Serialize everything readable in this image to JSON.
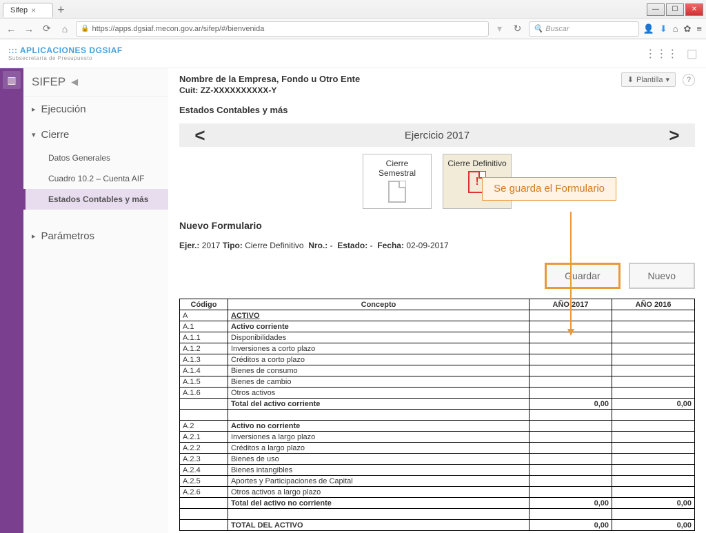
{
  "browser": {
    "tab_title": "Sifep",
    "url": "https://apps.dgsiaf.mecon.gov.ar/sifep/#/bienvenida",
    "search_placeholder": "Buscar"
  },
  "header": {
    "logo_line1": "APLICACIONES DGSIAF",
    "logo_line2": "Subsecretaría de Presupuesto",
    "plantilla_label": "Plantilla"
  },
  "sidebar": {
    "title": "SIFEP",
    "items": [
      {
        "label": "Ejecución",
        "expanded": false
      },
      {
        "label": "Cierre",
        "expanded": true,
        "children": [
          {
            "label": "Datos Generales",
            "active": false
          },
          {
            "label": "Cuadro 10.2  – Cuenta AIF",
            "active": false
          },
          {
            "label": "Estados Contables y más",
            "active": true
          }
        ]
      },
      {
        "label": "Parámetros",
        "expanded": false
      }
    ]
  },
  "main": {
    "company": "Nombre de la Empresa, Fondo u Otro Ente",
    "cuit": "Cuit: ZZ-XXXXXXXXXX-Y",
    "section": "Estados Contables y más",
    "ejercicio_label": "Ejercicio 2017",
    "cards": [
      {
        "label": "Cierre Semestral",
        "active": false
      },
      {
        "label": "Cierre Definitivo",
        "active": true
      }
    ],
    "form_title": "Nuevo Formulario",
    "meta": {
      "ejer_label": "Ejer.:",
      "ejer": "2017",
      "tipo_label": "Tipo:",
      "tipo": "Cierre Definitivo",
      "nro_label": "Nro.:",
      "nro": "-",
      "estado_label": "Estado:",
      "estado": "-",
      "fecha_label": "Fecha:",
      "fecha": "02-09-2017"
    },
    "buttons": {
      "guardar": "Guardar",
      "nuevo": "Nuevo"
    },
    "annotation": "Se guarda el Formulario"
  },
  "table": {
    "headers": [
      "Código",
      "Concepto",
      "AÑO 2017",
      "AÑO 2016"
    ],
    "rows": [
      {
        "codigo": "A",
        "concepto": "ACTIVO",
        "bold": true,
        "underline": true
      },
      {
        "codigo": "A.1",
        "concepto": "Activo corriente",
        "bold": true
      },
      {
        "codigo": "A.1.1",
        "concepto": "Disponibilidades"
      },
      {
        "codigo": "A.1.2",
        "concepto": "Inversiones a corto plazo"
      },
      {
        "codigo": "A.1.3",
        "concepto": "Créditos a corto plazo"
      },
      {
        "codigo": "A.1.4",
        "concepto": "Bienes de consumo"
      },
      {
        "codigo": "A.1.5",
        "concepto": "Bienes de cambio"
      },
      {
        "codigo": "A.1.6",
        "concepto": "Otros activos"
      },
      {
        "codigo": "",
        "concepto": "Total del activo corriente",
        "bold": true,
        "y1": "0,00",
        "y2": "0,00"
      },
      {
        "codigo": "",
        "concepto": ""
      },
      {
        "codigo": "A.2",
        "concepto": "Activo no corriente",
        "bold": true
      },
      {
        "codigo": "A.2.1",
        "concepto": "Inversiones a largo plazo"
      },
      {
        "codigo": "A.2.2",
        "concepto": "Créditos a largo plazo"
      },
      {
        "codigo": "A.2.3",
        "concepto": "Bienes de uso"
      },
      {
        "codigo": "A.2.4",
        "concepto": "Bienes intangibles"
      },
      {
        "codigo": "A.2.5",
        "concepto": "Aportes y Participaciones de Capital"
      },
      {
        "codigo": "A.2.6",
        "concepto": "Otros activos a largo plazo"
      },
      {
        "codigo": "",
        "concepto": "Total del activo no corriente",
        "bold": true,
        "y1": "0,00",
        "y2": "0,00"
      },
      {
        "codigo": "",
        "concepto": ""
      },
      {
        "codigo": "",
        "concepto": "TOTAL DEL ACTIVO",
        "bold": true,
        "y1": "0,00",
        "y2": "0,00"
      }
    ]
  }
}
